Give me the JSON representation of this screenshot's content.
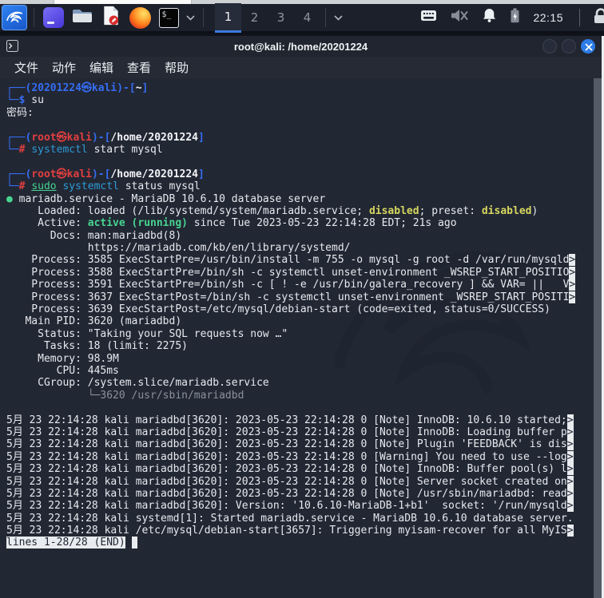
{
  "top_panel": {
    "launcher_icons": [
      "kali-menu",
      "window-app",
      "file-manager",
      "text-editor",
      "firefox",
      "terminal",
      "terminal-dropdown"
    ],
    "workspaces": [
      "1",
      "2",
      "3",
      "4"
    ],
    "active_workspace": "1",
    "tray_icons": [
      "keyboard-indicator",
      "volume-muted",
      "notifications-bell",
      "battery",
      "screen-lock"
    ],
    "clock": "22:15"
  },
  "window": {
    "title": "root@kali: /home/20201224",
    "menu": [
      "文件",
      "动作",
      "编辑",
      "查看",
      "帮助"
    ],
    "controls": [
      "minimize",
      "maximize",
      "close"
    ]
  },
  "colors": {
    "terminal_bg": "#222734",
    "panel_bg": "#1b202b",
    "prompt_blue": "#356df2",
    "prompt_red": "#e23f3f",
    "ok_green": "#47d48f",
    "command_cyan": "#2e9bd6",
    "disabled_yellow": "#d6d75e",
    "close_button_blue": "#2e7ce6"
  },
  "terminal": {
    "pager_status": "lines 1-28/28 (END)",
    "lines": [
      [
        {
          "t": "┌──(",
          "s": "blue-bold"
        },
        {
          "t": "20201224㉿kali",
          "s": "blue-bold"
        },
        {
          "t": ")-[",
          "s": "blue-bold"
        },
        {
          "t": "~",
          "s": "white-bold"
        },
        {
          "t": "]",
          "s": "blue-bold"
        }
      ],
      [
        {
          "t": "└─",
          "s": "blue-bold"
        },
        {
          "t": "$",
          "s": "blue-bold"
        },
        {
          "t": " su",
          "s": "white"
        }
      ],
      [
        {
          "t": "密码:",
          "s": "white"
        }
      ],
      [],
      [
        {
          "t": "┌──(",
          "s": "blue-bold"
        },
        {
          "t": "root㉿kali",
          "s": "red-bold"
        },
        {
          "t": ")-[",
          "s": "blue-bold"
        },
        {
          "t": "/home/20201224",
          "s": "white-bold"
        },
        {
          "t": "]",
          "s": "blue-bold"
        }
      ],
      [
        {
          "t": "└─",
          "s": "blue-bold"
        },
        {
          "t": "#",
          "s": "red-bold"
        },
        {
          "t": " ",
          "s": "white"
        },
        {
          "t": "systemctl",
          "s": "cyan"
        },
        {
          "t": " start mysql",
          "s": "white"
        }
      ],
      [],
      [
        {
          "t": "┌──(",
          "s": "blue-bold"
        },
        {
          "t": "root㉿kali",
          "s": "red-bold"
        },
        {
          "t": ")-[",
          "s": "blue-bold"
        },
        {
          "t": "/home/20201224",
          "s": "white-bold"
        },
        {
          "t": "]",
          "s": "blue-bold"
        }
      ],
      [
        {
          "t": "└─",
          "s": "blue-bold"
        },
        {
          "t": "#",
          "s": "red-bold"
        },
        {
          "t": " ",
          "s": "white"
        },
        {
          "t": "sudo",
          "s": "green-underline"
        },
        {
          "t": " ",
          "s": "white"
        },
        {
          "t": "systemctl",
          "s": "cyan"
        },
        {
          "t": " status mysql",
          "s": "white"
        }
      ],
      [
        {
          "t": "● ",
          "s": "green"
        },
        {
          "t": "mariadb.service - MariaDB 10.6.10 database server",
          "s": "white"
        }
      ],
      [
        {
          "t": "     Loaded: loaded (/lib/systemd/system/mariadb.service; ",
          "s": "white"
        },
        {
          "t": "disabled",
          "s": "yellow-bold"
        },
        {
          "t": "; preset: ",
          "s": "white"
        },
        {
          "t": "disabled",
          "s": "yellow-bold"
        },
        {
          "t": ")",
          "s": "white"
        }
      ],
      [
        {
          "t": "     Active: ",
          "s": "white"
        },
        {
          "t": "active (running)",
          "s": "green-bold"
        },
        {
          "t": " since Tue 2023-05-23 22:14:28 EDT; 21s ago",
          "s": "white"
        }
      ],
      [
        {
          "t": "       Docs: man:mariadbd(8)",
          "s": "white"
        }
      ],
      [
        {
          "t": "             https://mariadb.com/kb/en/library/systemd/",
          "s": "white"
        }
      ],
      [
        {
          "t": "    Process: 3585 ExecStartPre=/usr/bin/install -m 755 -o mysql -g root -d /var/run/mysqld",
          "s": "white"
        },
        {
          "t": ">",
          "s": "inverse"
        }
      ],
      [
        {
          "t": "    Process: 3588 ExecStartPre=/bin/sh -c systemctl unset-environment _WSREP_START_POSITIO",
          "s": "white"
        },
        {
          "t": ">",
          "s": "inverse"
        }
      ],
      [
        {
          "t": "    Process: 3591 ExecStartPre=/bin/sh -c [ ! -e /usr/bin/galera_recovery ] && VAR= ||   V",
          "s": "white"
        },
        {
          "t": ">",
          "s": "inverse"
        }
      ],
      [
        {
          "t": "    Process: 3637 ExecStartPost=/bin/sh -c systemctl unset-environment _WSREP_START_POSITI",
          "s": "white"
        },
        {
          "t": ">",
          "s": "inverse"
        }
      ],
      [
        {
          "t": "    Process: 3639 ExecStartPost=/etc/mysql/debian-start (code=exited, status=0/SUCCESS)",
          "s": "white"
        }
      ],
      [
        {
          "t": "   Main PID: 3620 (mariadbd)",
          "s": "white"
        }
      ],
      [
        {
          "t": "     Status: \"Taking your SQL requests now …\"",
          "s": "white"
        }
      ],
      [
        {
          "t": "      Tasks: 18 (limit: 2275)",
          "s": "white"
        }
      ],
      [
        {
          "t": "     Memory: 98.9M",
          "s": "white"
        }
      ],
      [
        {
          "t": "        CPU: 445ms",
          "s": "white"
        }
      ],
      [
        {
          "t": "     CGroup: /system.slice/mariadb.service",
          "s": "white"
        }
      ],
      [
        {
          "t": "             └─3620 /usr/sbin/mariadbd",
          "s": "dim"
        }
      ],
      [],
      [
        {
          "t": "5月 23 22:14:28 kali mariadbd[3620]: 2023-05-23 22:14:28 0 [Note] InnoDB: 10.6.10 started;",
          "s": "white"
        },
        {
          "t": ">",
          "s": "inverse"
        }
      ],
      [
        {
          "t": "5月 23 22:14:28 kali mariadbd[3620]: 2023-05-23 22:14:28 0 [Note] InnoDB: Loading buffer p",
          "s": "white"
        },
        {
          "t": ">",
          "s": "inverse"
        }
      ],
      [
        {
          "t": "5月 23 22:14:28 kali mariadbd[3620]: 2023-05-23 22:14:28 0 [Note] Plugin 'FEEDBACK' is dis",
          "s": "white"
        },
        {
          "t": ">",
          "s": "inverse"
        }
      ],
      [
        {
          "t": "5月 23 22:14:28 kali mariadbd[3620]: 2023-05-23 22:14:28 0 [Warning] You need to use --log",
          "s": "white"
        },
        {
          "t": ">",
          "s": "inverse"
        }
      ],
      [
        {
          "t": "5月 23 22:14:28 kali mariadbd[3620]: 2023-05-23 22:14:28 0 [Note] InnoDB: Buffer pool(s) l",
          "s": "white"
        },
        {
          "t": ">",
          "s": "inverse"
        }
      ],
      [
        {
          "t": "5月 23 22:14:28 kali mariadbd[3620]: 2023-05-23 22:14:28 0 [Note] Server socket created on",
          "s": "white"
        },
        {
          "t": ">",
          "s": "inverse"
        }
      ],
      [
        {
          "t": "5月 23 22:14:28 kali mariadbd[3620]: 2023-05-23 22:14:28 0 [Note] /usr/sbin/mariadbd: read",
          "s": "white"
        },
        {
          "t": ">",
          "s": "inverse"
        }
      ],
      [
        {
          "t": "5月 23 22:14:28 kali mariadbd[3620]: Version: '10.6.10-MariaDB-1+b1'  socket: '/run/mysqld",
          "s": "white"
        },
        {
          "t": ">",
          "s": "inverse"
        }
      ],
      [
        {
          "t": "5月 23 22:14:28 kali systemd[1]: Started mariadb.service - MariaDB 10.6.10 database server.",
          "s": "white"
        }
      ],
      [
        {
          "t": "5月 23 22:14:28 kali /etc/mysql/debian-start[3657]: Triggering myisam-recover for all MyIS",
          "s": "white"
        },
        {
          "t": ">",
          "s": "inverse"
        }
      ],
      [
        {
          "t": "lines 1-28/28 (END)",
          "s": "inverse"
        },
        {
          "t": " ",
          "s": "white"
        },
        {
          "t": " ",
          "s": "inverse"
        }
      ]
    ]
  }
}
